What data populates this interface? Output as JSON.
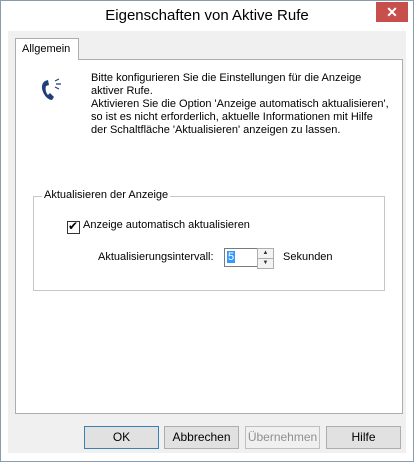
{
  "window": {
    "title": "Eigenschaften von Aktive Rufe",
    "close_glyph": "✕"
  },
  "tabs": [
    {
      "label": "Allgemein"
    }
  ],
  "intro": {
    "icon": "telephone-icon",
    "line1": "Bitte konfigurieren Sie die Einstellungen für die Anzeige aktiver Rufe.",
    "line2": "Aktivieren Sie die Option 'Anzeige automatisch aktualisieren', so ist es nicht erforderlich, aktuelle Informationen mit Hilfe der Schaltfläche 'Aktualisieren' anzeigen zu lassen."
  },
  "refresh_group": {
    "legend": "Aktualisieren der Anzeige",
    "auto_refresh": {
      "label": "Anzeige automatisch aktualisieren",
      "checked": true,
      "mark": "✔"
    },
    "interval": {
      "label": "Aktualisierungsintervall:",
      "value": "5",
      "unit": "Sekunden"
    }
  },
  "buttons": {
    "ok": "OK",
    "cancel": "Abbrechen",
    "apply": "Übernehmen",
    "help": "Hilfe"
  }
}
